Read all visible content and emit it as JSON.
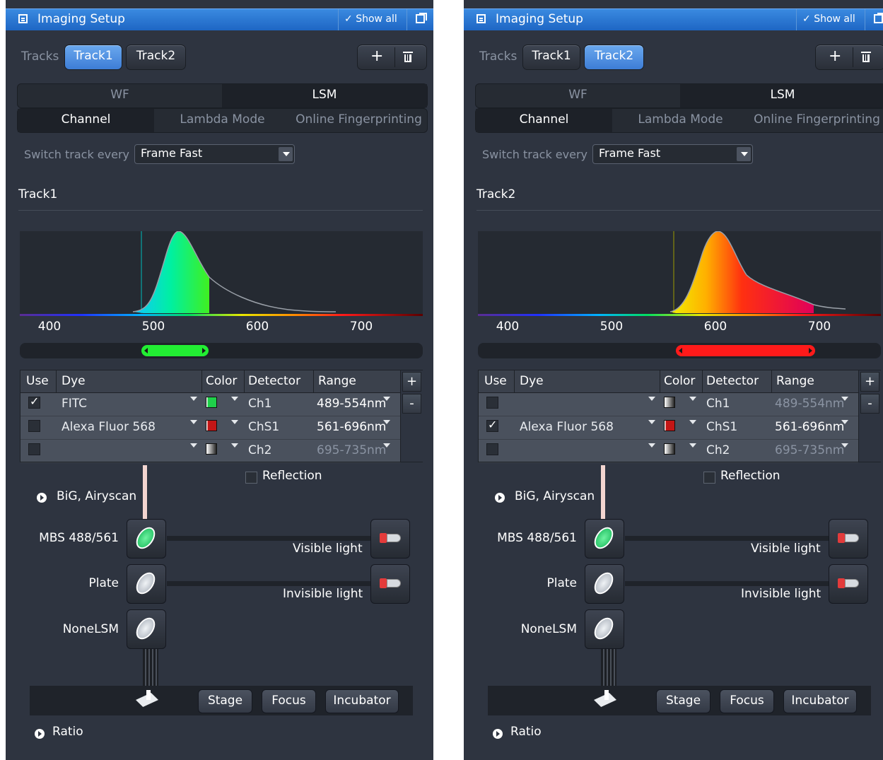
{
  "panels": [
    {
      "title": "Imaging Setup",
      "show_all": "Show all",
      "tracks_label": "Tracks",
      "tracks": [
        "Track1",
        "Track2"
      ],
      "active_track": 0,
      "seg1": [
        "WF",
        "LSM"
      ],
      "seg2": [
        "Channel",
        "Lambda Mode",
        "Online Fingerprinting"
      ],
      "switch_label": "Switch track every",
      "switch_value": "Frame Fast",
      "heading": "Track1",
      "wavelengths": [
        "400",
        "500",
        "600",
        "700"
      ],
      "range_color": "#22ee33",
      "table": {
        "headers": [
          "Use",
          "Dye",
          "Color",
          "Detector",
          "Range"
        ],
        "rows": [
          {
            "use": true,
            "dye": "FITC",
            "color": "#1fd04a",
            "detector": "Ch1",
            "range": "489-554nm"
          },
          {
            "use": false,
            "dye": "Alexa Fluor 568",
            "color": "#c41616",
            "detector": "ChS1",
            "range": "561-696nm"
          },
          {
            "use": false,
            "dye": "",
            "color": "gray",
            "detector": "Ch2",
            "range": "695-735nm"
          }
        ],
        "add": "+",
        "remove": "-"
      },
      "reflection": "Reflection",
      "expander1": "BiG, Airyscan",
      "elements": [
        "MBS 488/561",
        "Plate",
        "NoneLSM"
      ],
      "lights": [
        "Visible light",
        "Invisible light"
      ],
      "buttons": [
        "Stage",
        "Focus",
        "Incubator"
      ],
      "expander2": "Ratio"
    },
    {
      "title": "Imaging Setup",
      "show_all": "Show all",
      "tracks_label": "Tracks",
      "tracks": [
        "Track1",
        "Track2"
      ],
      "active_track": 1,
      "seg1": [
        "WF",
        "LSM"
      ],
      "seg2": [
        "Channel",
        "Lambda Mode",
        "Online Fingerprinting"
      ],
      "switch_label": "Switch track every",
      "switch_value": "Frame Fast",
      "heading": "Track2",
      "wavelengths": [
        "400",
        "500",
        "600",
        "700"
      ],
      "range_color": "#ff1a1a",
      "table": {
        "headers": [
          "Use",
          "Dye",
          "Color",
          "Detector",
          "Range"
        ],
        "rows": [
          {
            "use": false,
            "dye": "",
            "color": "gray",
            "detector": "Ch1",
            "range": "489-554nm"
          },
          {
            "use": true,
            "dye": "Alexa Fluor 568",
            "color": "#c41616",
            "detector": "ChS1",
            "range": "561-696nm"
          },
          {
            "use": false,
            "dye": "",
            "color": "gray",
            "detector": "Ch2",
            "range": "695-735nm"
          }
        ],
        "add": "+",
        "remove": "-"
      },
      "reflection": "Reflection",
      "expander1": "BiG, Airyscan",
      "elements": [
        "MBS 488/561",
        "Plate",
        "NoneLSM"
      ],
      "lights": [
        "Visible light",
        "Invisible light"
      ],
      "buttons": [
        "Stage",
        "Focus",
        "Incubator"
      ],
      "expander2": "Ratio"
    }
  ]
}
